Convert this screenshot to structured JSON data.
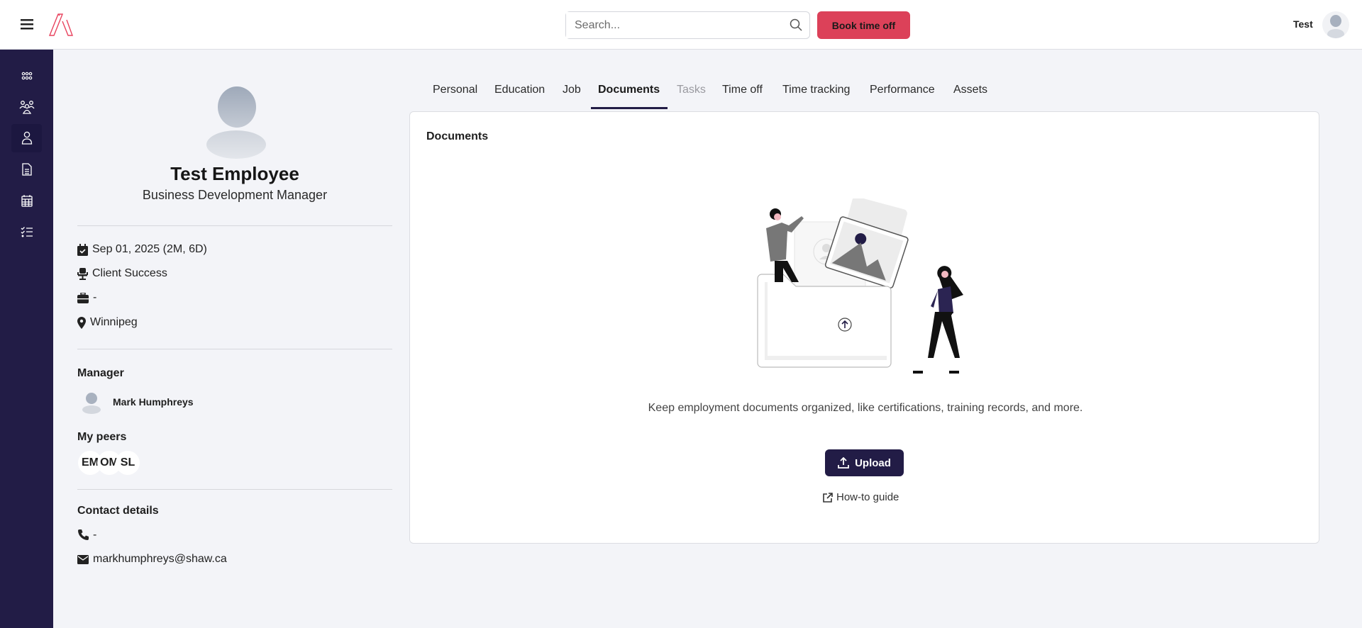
{
  "header": {
    "search_placeholder": "Search...",
    "book_time_off": "Book time off",
    "user_name": "Test"
  },
  "sidebar": {
    "items": [
      "dashboard",
      "people",
      "my-profile",
      "documents",
      "calendar",
      "tasks"
    ],
    "active": "my-profile"
  },
  "profile": {
    "name": "Test Employee",
    "title": "Business Development Manager",
    "start_date": "Sep 01, 2025 (2M, 6D)",
    "department": "Client Success",
    "job": "-",
    "location": "Winnipeg",
    "manager_label": "Manager",
    "manager_name": "Mark Humphreys",
    "peers_label": "My peers",
    "peers": [
      "EM",
      "OM",
      "SL"
    ],
    "contact_label": "Contact details",
    "phone": "-",
    "email": "markhumphreys@shaw.ca"
  },
  "tabs": [
    "Personal",
    "Education",
    "Job",
    "Documents",
    "Tasks",
    "Time off",
    "Time tracking",
    "Performance",
    "Assets"
  ],
  "active_tab": "Documents",
  "documents": {
    "title": "Documents",
    "empty_text": "Keep employment documents organized, like certifications, training records, and more.",
    "upload": "Upload",
    "guide": "How-to guide"
  },
  "colors": {
    "sidebar": "#221c46",
    "accent": "#dc4159",
    "primary": "#221c46"
  }
}
